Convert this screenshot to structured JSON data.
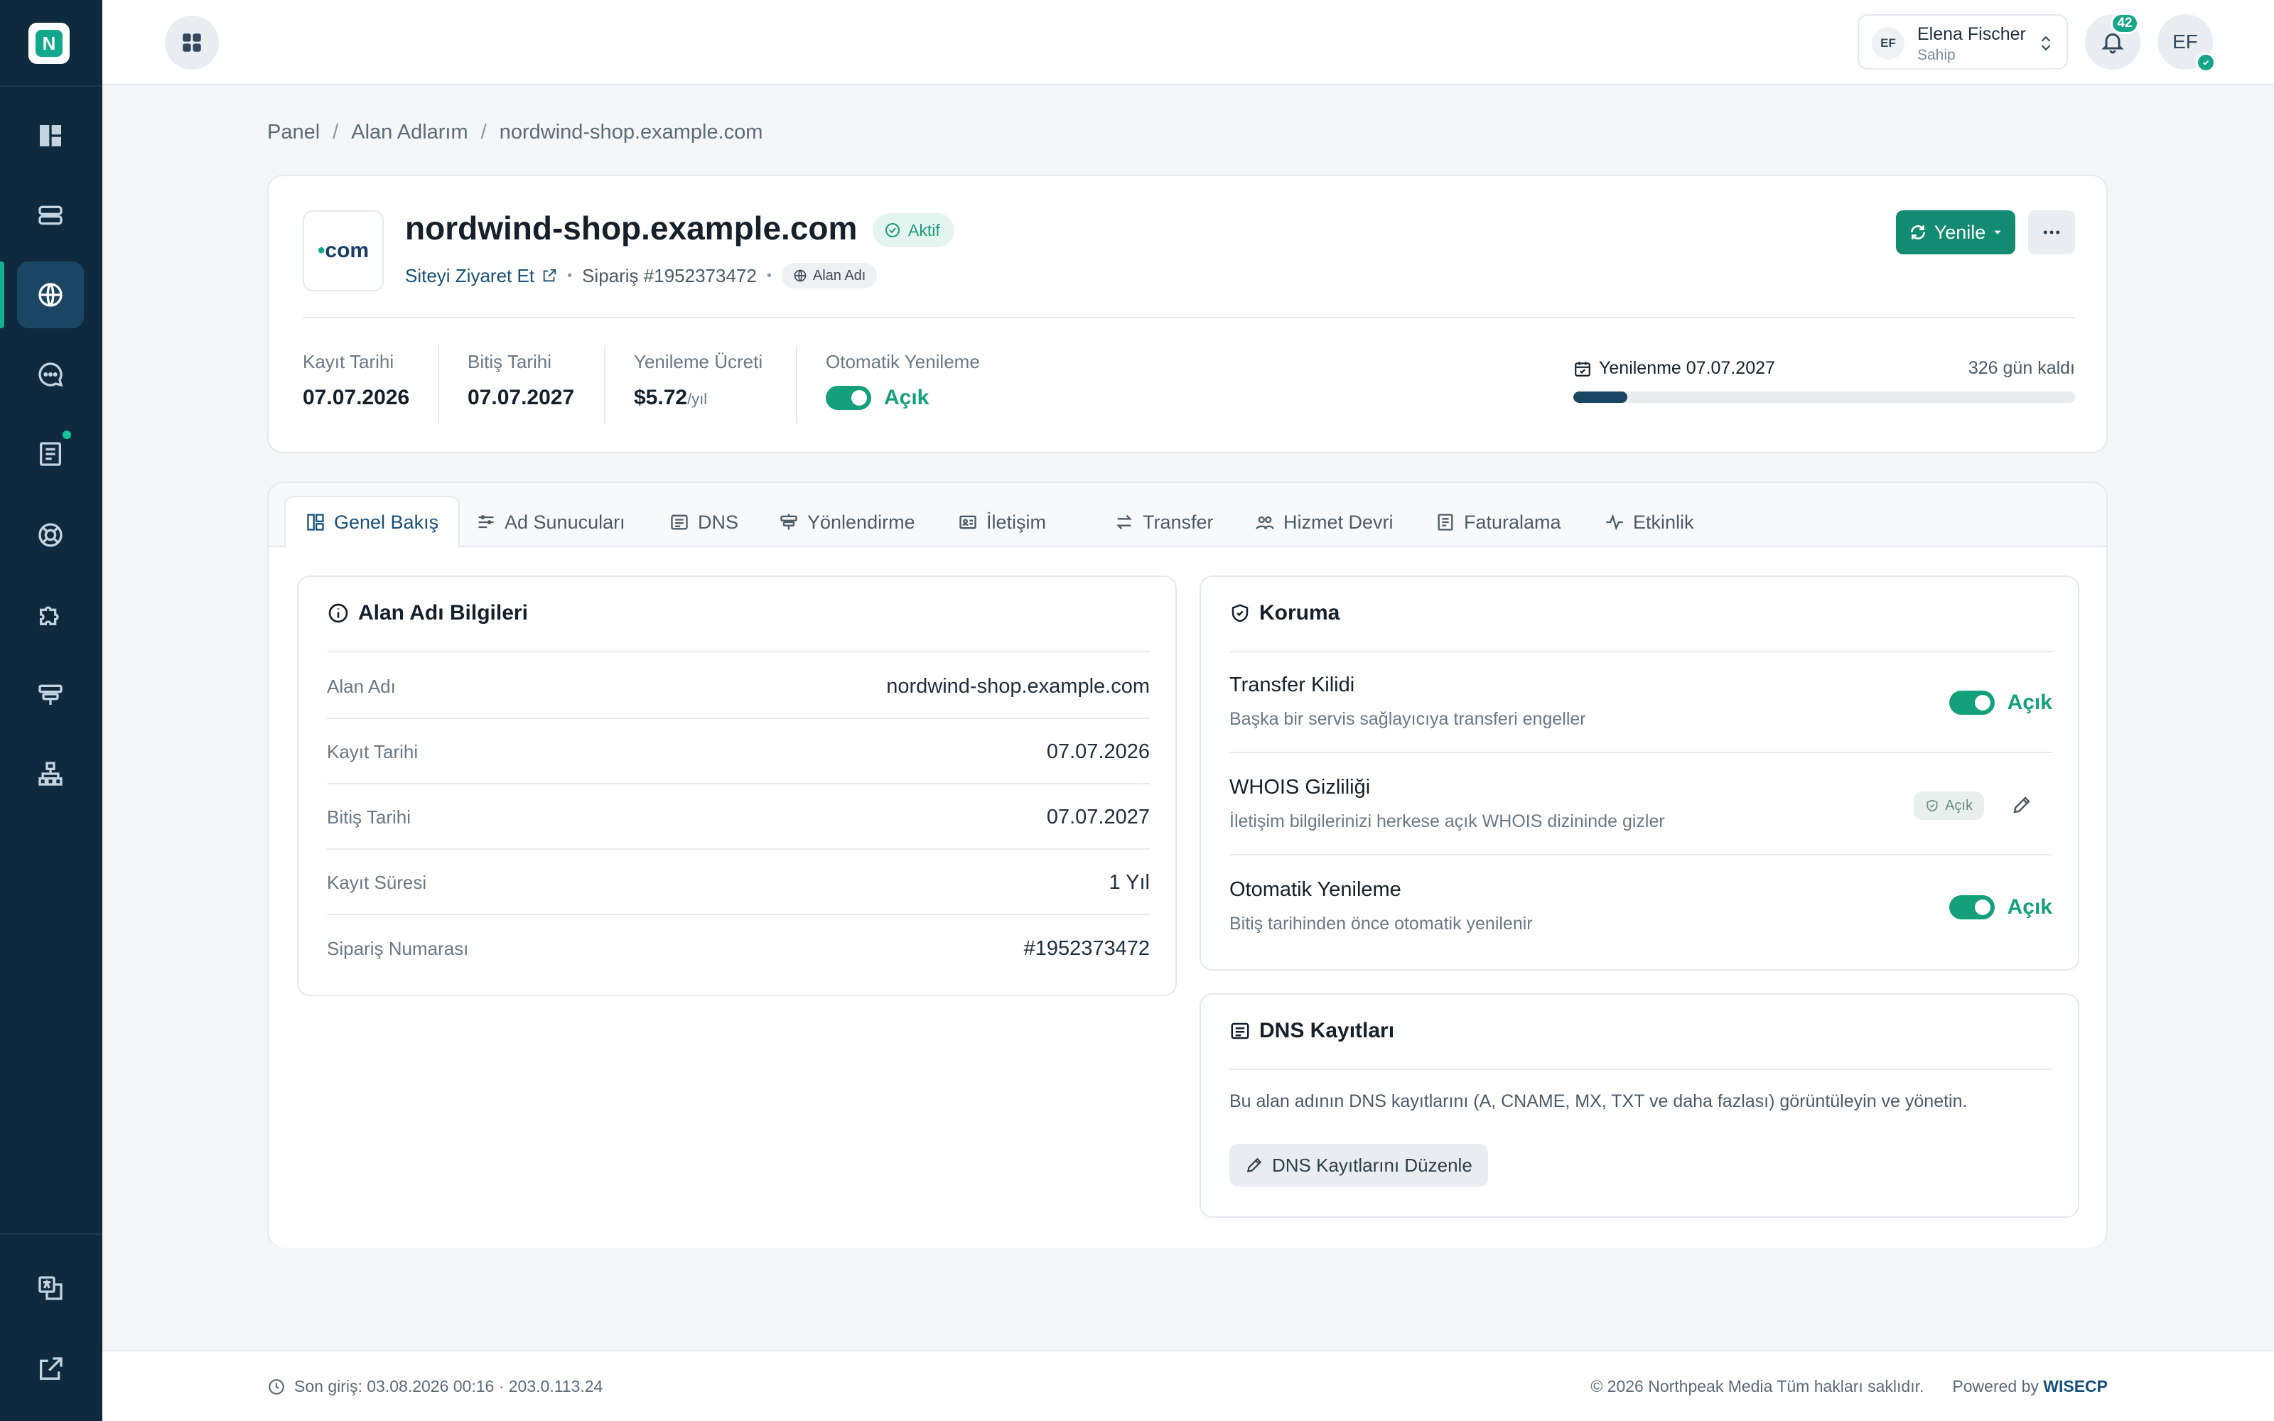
{
  "app": {
    "logo_letter": "N"
  },
  "sidebar": {
    "items": [
      {
        "name": "dashboard",
        "icon": "dashboard-icon"
      },
      {
        "name": "servers",
        "icon": "server-icon"
      },
      {
        "name": "domains",
        "icon": "globe-icon",
        "active": true
      },
      {
        "name": "support",
        "icon": "chat-icon"
      },
      {
        "name": "invoices",
        "icon": "invoice-icon",
        "has_dot": true
      },
      {
        "name": "help",
        "icon": "lifebuoy-icon"
      },
      {
        "name": "addons",
        "icon": "puzzle-icon"
      },
      {
        "name": "signs",
        "icon": "signpost-icon"
      },
      {
        "name": "network",
        "icon": "sitemap-icon"
      }
    ],
    "bottom_items": [
      {
        "name": "language",
        "icon": "translate-icon"
      },
      {
        "name": "external",
        "icon": "external-link-icon"
      }
    ]
  },
  "topbar": {
    "user": {
      "initials": "EF",
      "name": "Elena Fischer",
      "role": "Sahip"
    },
    "notification_count": "42",
    "avatar_initials": "EF"
  },
  "breadcrumb": [
    "Panel",
    "Alan Adlarım",
    "nordwind-shop.example.com"
  ],
  "domain": {
    "tld": ".com",
    "name": "nordwind-shop.example.com",
    "status": "Aktif",
    "visit_label": "Siteyi Ziyaret Et",
    "order": "Sipariş #1952373472",
    "type": "Alan Adı",
    "renew_button": "Yenile"
  },
  "meta": {
    "registration": {
      "label": "Kayıt Tarihi",
      "value": "07.07.2026"
    },
    "expiry": {
      "label": "Bitiş Tarihi",
      "value": "07.07.2027"
    },
    "renewal_fee": {
      "label": "Yenileme Ücreti",
      "value": "$5.72",
      "unit": "/yıl"
    },
    "auto_renew": {
      "label": "Otomatik Yenileme",
      "value": "Açık"
    },
    "renewal": {
      "label": "Yenilenme 07.07.2027",
      "days_left": "326 gün kaldı",
      "progress": 0.107
    }
  },
  "tabs": [
    {
      "label": "Genel Bakış",
      "icon": "layout-icon",
      "active": true
    },
    {
      "label": "Ad Sunucuları",
      "icon": "nameserver-icon"
    },
    {
      "label": "DNS",
      "icon": "list-icon"
    },
    {
      "label": "Yönlendirme",
      "icon": "signpost-icon"
    },
    {
      "label": "İletişim",
      "icon": "contact-card-icon"
    },
    {
      "label": "Transfer",
      "icon": "transfer-icon"
    },
    {
      "label": "Hizmet Devri",
      "icon": "users-icon"
    },
    {
      "label": "Faturalama",
      "icon": "billing-icon"
    },
    {
      "label": "Etkinlik",
      "icon": "activity-icon"
    }
  ],
  "domain_info": {
    "title": "Alan Adı Bilgileri",
    "rows": [
      {
        "key": "Alan Adı",
        "value": "nordwind-shop.example.com"
      },
      {
        "key": "Kayıt Tarihi",
        "value": "07.07.2026"
      },
      {
        "key": "Bitiş Tarihi",
        "value": "07.07.2027"
      },
      {
        "key": "Kayıt Süresi",
        "value": "1 Yıl"
      },
      {
        "key": "Sipariş Numarası",
        "value": "#1952373472"
      }
    ]
  },
  "protection": {
    "title": "Koruma",
    "rows": [
      {
        "name": "Transfer Kilidi",
        "desc": "Başka bir servis sağlayıcıya transferi engeller",
        "state": "Açık"
      },
      {
        "name": "WHOIS Gizliliği",
        "desc": "İletişim bilgilerinizi herkese açık WHOIS dizininde gizler",
        "state": "Açık"
      },
      {
        "name": "Otomatik Yenileme",
        "desc": "Bitiş tarihinden önce otomatik yenilenir",
        "state": "Açık"
      }
    ]
  },
  "dns": {
    "title": "DNS Kayıtları",
    "desc": "Bu alan adının DNS kayıtlarını (A, CNAME, MX, TXT ve daha fazlası) görüntüleyin ve yönetin.",
    "button": "DNS Kayıtlarını Düzenle"
  },
  "footer": {
    "last_login": "Son giriş: 03.08.2026 00:16 · 203.0.113.24",
    "copyright": "© 2026 Northpeak Media Tüm hakları saklıdır.",
    "powered_prefix": "Powered by",
    "powered_brand": "WISECP"
  },
  "colors": {
    "accent": "#138b72",
    "sidebar": "#0f2a3f",
    "link": "#17507a"
  }
}
